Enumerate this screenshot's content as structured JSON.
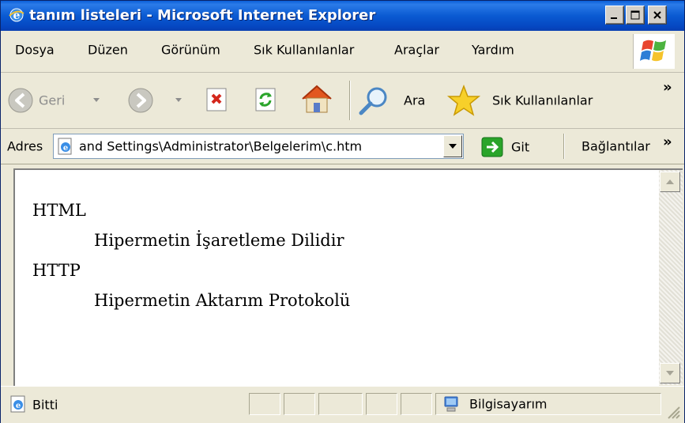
{
  "window": {
    "title": "tanım listeleri - Microsoft Internet Explorer",
    "icon": "ie-logo-icon"
  },
  "menu": {
    "items": [
      "Dosya",
      "Düzen",
      "Görünüm",
      "Sık Kullanılanlar",
      "Araçlar",
      "Yardım"
    ]
  },
  "toolbar": {
    "back_label": "Geri",
    "search_label": "Ara",
    "favorites_label": "Sık Kullanılanlar",
    "overflow": "»"
  },
  "address": {
    "label": "Adres",
    "value": "and Settings\\Administrator\\Belgelerim\\c.htm",
    "go_label": "Git",
    "links_label": "Bağlantılar",
    "overflow": "»"
  },
  "content": {
    "definitions": [
      {
        "term": "HTML",
        "description": "Hipermetin İşaretleme Dilidir"
      },
      {
        "term": "HTTP",
        "description": "Hipermetin Aktarım Protokolü"
      }
    ]
  },
  "status": {
    "text": "Bitti",
    "zone": "Bilgisayarım"
  },
  "colors": {
    "titlebar": "#0a5ad2",
    "chrome": "#ece9d8",
    "go_button": "#2aa42a"
  }
}
